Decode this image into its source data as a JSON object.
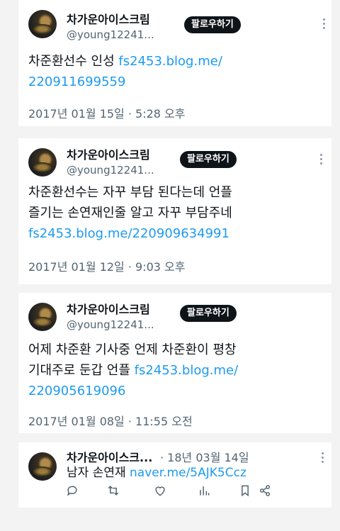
{
  "tweets": [
    {
      "display_name": "차가운아이스크림",
      "handle": "@young12241...",
      "follow_label": "팔로우하기",
      "text_plain": "차준환선수 인성 ",
      "link_line1": "fs2453.blog.me/",
      "link_line2": "220911699559",
      "timestamp": "2017년 01월 15일 · 5:28 오후"
    },
    {
      "display_name": "차가운아이스크림",
      "handle": "@young12241...",
      "follow_label": "팔로우하기",
      "line1": "차준환선수는 자꾸 부담 된다는데 언플",
      "line2": "즐기는 손연재인줄 알고 자꾸 부담주네",
      "link": "fs2453.blog.me/220909634991",
      "timestamp": "2017년 01월 12일 · 9:03 오후"
    },
    {
      "display_name": "차가운아이스크림",
      "handle": "@young12241...",
      "follow_label": "팔로우하기",
      "line1": "어제 차준환 기사중 언제 차준환이 평창",
      "line2_plain": "기대주로 둔갑 언플  ",
      "link_part1": "fs2453.blog.me/",
      "link_part2": "220905619096",
      "timestamp": "2017년 01월 08일 · 11:55 오전"
    },
    {
      "display_name": "차가운아이스크...",
      "date": "· 18년 03월 14일",
      "text_plain": "남자 손연재 ",
      "link": "naver.me/5AJK5Ccz",
      "action_icons": [
        "reply-icon",
        "retweet-icon",
        "like-icon",
        "views-icon",
        "bookmark-icon",
        "share-icon"
      ]
    }
  ]
}
